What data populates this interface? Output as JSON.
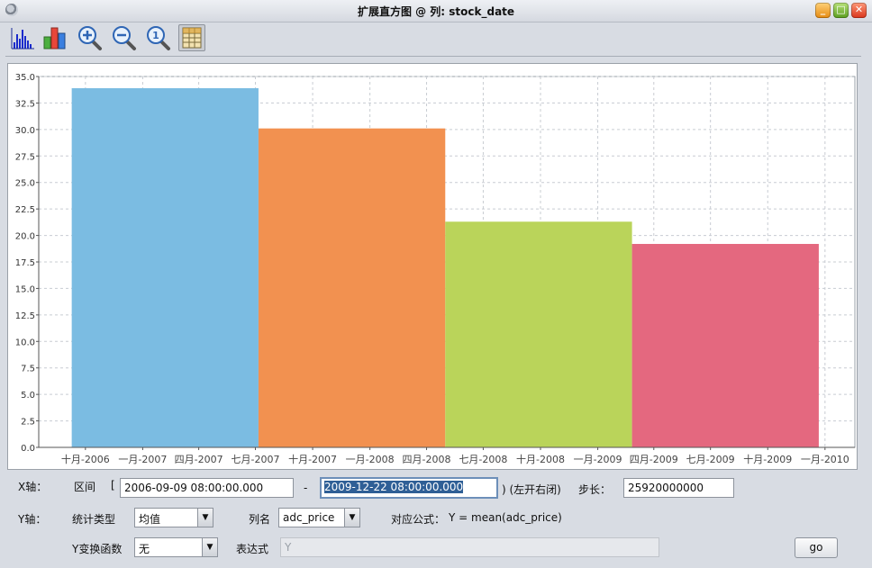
{
  "window": {
    "title": "扩展直方图 @ 列: stock_date",
    "buttons": [
      "minimize",
      "maximize",
      "close"
    ]
  },
  "toolbar": {
    "tools": [
      {
        "name": "histogram-tool",
        "icon": "histogram-icon"
      },
      {
        "name": "bar-chart-tool",
        "icon": "bar-chart-icon"
      },
      {
        "name": "zoom-in-tool",
        "icon": "zoom-in-icon"
      },
      {
        "name": "zoom-out-tool",
        "icon": "zoom-out-icon"
      },
      {
        "name": "zoom-reset-tool",
        "icon": "zoom-reset-icon"
      },
      {
        "name": "data-table-tool",
        "icon": "data-table-icon",
        "pressed": true
      }
    ]
  },
  "chart_data": {
    "type": "bar",
    "categories": [
      "2006-09-09 – 2007-07-06",
      "2007-07-06 – 2008-05-01",
      "2008-05-01 – 2009-02-25",
      "2009-02-25 – 2009-12-22"
    ],
    "values": [
      33.9,
      30.1,
      21.3,
      19.2
    ],
    "colors": [
      "#7bbce2",
      "#f29150",
      "#bad45a",
      "#e4687f"
    ],
    "ylim": [
      0,
      35
    ],
    "yticks": [
      "0.0",
      "2.5",
      "5.0",
      "7.5",
      "10.0",
      "12.5",
      "15.0",
      "17.5",
      "20.0",
      "22.5",
      "25.0",
      "27.5",
      "30.0",
      "32.5",
      "35.0"
    ],
    "xlim": [
      "2006-07-18",
      "2010-02-18"
    ],
    "xticks": [
      {
        "date": "2006-10-01",
        "label": "十月-2006"
      },
      {
        "date": "2007-01-01",
        "label": "一月-2007"
      },
      {
        "date": "2007-04-01",
        "label": "四月-2007"
      },
      {
        "date": "2007-07-01",
        "label": "七月-2007"
      },
      {
        "date": "2007-10-01",
        "label": "十月-2007"
      },
      {
        "date": "2008-01-01",
        "label": "一月-2008"
      },
      {
        "date": "2008-04-01",
        "label": "四月-2008"
      },
      {
        "date": "2008-07-01",
        "label": "七月-2008"
      },
      {
        "date": "2008-10-01",
        "label": "十月-2008"
      },
      {
        "date": "2009-01-01",
        "label": "一月-2009"
      },
      {
        "date": "2009-04-01",
        "label": "四月-2009"
      },
      {
        "date": "2009-07-01",
        "label": "七月-2009"
      },
      {
        "date": "2009-10-01",
        "label": "十月-2009"
      },
      {
        "date": "2010-01-01",
        "label": "一月-2010"
      }
    ],
    "grid": true
  },
  "x_axis": {
    "label": "X轴：",
    "range_label": "区间",
    "open_bracket": "[",
    "start": "2006-09-09 08:00:00.000",
    "dash": "-",
    "end": "2009-12-22 08:00:00.000",
    "close_note": ") (左开右闭)",
    "step_label": "步长：",
    "step": "25920000000"
  },
  "y_axis": {
    "label": "Y轴：",
    "stat_label": "统计类型",
    "stat_value": "均值",
    "column_label": "列名",
    "column_value": "adc_price",
    "formula_label": "对应公式：",
    "formula": "Y = mean(adc_price)",
    "transform_label": "Y变换函数",
    "transform_value": "无",
    "expr_label": "表达式",
    "expr_placeholder": "Y",
    "go_label": "go"
  }
}
